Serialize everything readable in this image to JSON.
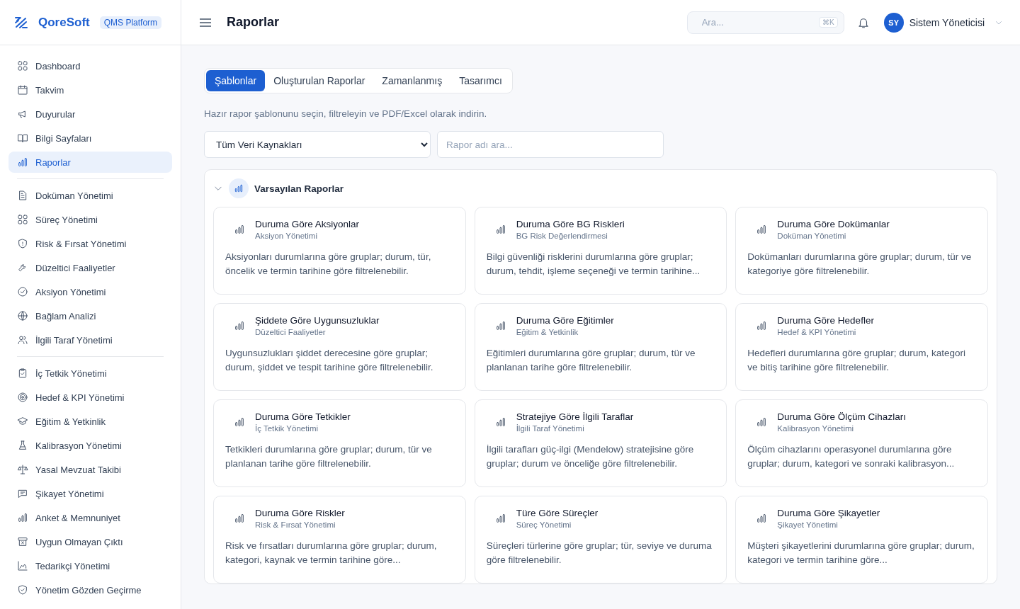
{
  "brand": {
    "name": "QoreSoft",
    "badge": "QMS Platform"
  },
  "sidebar": {
    "groups": [
      {
        "items": [
          {
            "label": "Dashboard",
            "selected": false
          },
          {
            "label": "Takvim",
            "selected": false
          },
          {
            "label": "Duyurular",
            "selected": false
          },
          {
            "label": "Bilgi Sayfaları",
            "selected": false
          },
          {
            "label": "Raporlar",
            "selected": true
          }
        ]
      },
      {
        "items": [
          {
            "label": "Doküman Yönetimi",
            "selected": false
          },
          {
            "label": "Süreç Yönetimi",
            "selected": false
          },
          {
            "label": "Risk & Fırsat Yönetimi",
            "selected": false
          },
          {
            "label": "Düzeltici Faaliyetler",
            "selected": false
          },
          {
            "label": "Aksiyon Yönetimi",
            "selected": false
          },
          {
            "label": "Bağlam Analizi",
            "selected": false
          },
          {
            "label": "İlgili Taraf Yönetimi",
            "selected": false
          }
        ]
      },
      {
        "items": [
          {
            "label": "İç Tetkik Yönetimi",
            "selected": false
          },
          {
            "label": "Hedef & KPI Yönetimi",
            "selected": false
          },
          {
            "label": "Eğitim & Yetkinlik",
            "selected": false
          },
          {
            "label": "Kalibrasyon Yönetimi",
            "selected": false
          },
          {
            "label": "Yasal Mevzuat Takibi",
            "selected": false
          },
          {
            "label": "Şikayet Yönetimi",
            "selected": false
          },
          {
            "label": "Anket & Memnuniyet",
            "selected": false
          },
          {
            "label": "Uygun Olmayan Çıktı",
            "selected": false
          },
          {
            "label": "Tedarikçi Yönetimi",
            "selected": false
          },
          {
            "label": "Yönetim Gözden Geçirme",
            "selected": false
          }
        ]
      }
    ]
  },
  "header": {
    "title": "Raporlar",
    "search": {
      "placeholder": "Ara...",
      "shortcut": "⌘K"
    },
    "user": {
      "initials": "SY",
      "name": "Sistem Yöneticisi"
    }
  },
  "tabs": [
    {
      "label": "Şablonlar",
      "selected": true
    },
    {
      "label": "Oluşturulan Raporlar",
      "selected": false
    },
    {
      "label": "Zamanlanmış",
      "selected": false
    },
    {
      "label": "Tasarımcı",
      "selected": false
    }
  ],
  "intro": "Hazır rapor şablonunu seçin, filtreleyin ve PDF/Excel olarak indirin.",
  "filters": {
    "source": "Tüm Veri Kaynakları",
    "search_placeholder": "Rapor adı ara..."
  },
  "section": {
    "title": "Varsayılan Raporlar",
    "expanded": true,
    "cards": [
      {
        "title": "Duruma Göre Aksiyonlar",
        "module": "Aksiyon Yönetimi",
        "description": "Aksiyonları durumlarına göre gruplar; durum, tür, öncelik ve termin tarihine göre filtrelenebilir."
      },
      {
        "title": "Duruma Göre BG Riskleri",
        "module": "BG Risk Değerlendirmesi",
        "description": "Bilgi güvenliği risklerini durumlarına göre gruplar; durum, tehdit, işleme seçeneği ve termin tarihine..."
      },
      {
        "title": "Duruma Göre Dokümanlar",
        "module": "Doküman Yönetimi",
        "description": "Dokümanları durumlarına göre gruplar; durum, tür ve kategoriye göre filtrelenebilir."
      },
      {
        "title": "Şiddete Göre Uygunsuzluklar",
        "module": "Düzeltici Faaliyetler",
        "description": "Uygunsuzlukları şiddet derecesine göre gruplar; durum, şiddet ve tespit tarihine göre filtrelenebilir."
      },
      {
        "title": "Duruma Göre Eğitimler",
        "module": "Eğitim & Yetkinlik",
        "description": "Eğitimleri durumlarına göre gruplar; durum, tür ve planlanan tarihe göre filtrelenebilir."
      },
      {
        "title": "Duruma Göre Hedefler",
        "module": "Hedef & KPI Yönetimi",
        "description": "Hedefleri durumlarına göre gruplar; durum, kategori ve bitiş tarihine göre filtrelenebilir."
      },
      {
        "title": "Duruma Göre Tetkikler",
        "module": "İç Tetkik Yönetimi",
        "description": "Tetkikleri durumlarına göre gruplar; durum, tür ve planlanan tarihe göre filtrelenebilir."
      },
      {
        "title": "Stratejiye Göre İlgili Taraflar",
        "module": "İlgili Taraf Yönetimi",
        "description": "İlgili tarafları güç-ilgi (Mendelow) stratejisine göre gruplar; durum ve önceliğe göre filtrelenebilir."
      },
      {
        "title": "Duruma Göre Ölçüm Cihazları",
        "module": "Kalibrasyon Yönetimi",
        "description": "Ölçüm cihazlarını operasyonel durumlarına göre gruplar; durum, kategori ve sonraki kalibrasyon..."
      },
      {
        "title": "Duruma Göre Riskler",
        "module": "Risk & Fırsat Yönetimi",
        "description": "Risk ve fırsatları durumlarına göre gruplar; durum, kategori, kaynak ve termin tarihine göre..."
      },
      {
        "title": "Türe Göre Süreçler",
        "module": "Süreç Yönetimi",
        "description": "Süreçleri türlerine göre gruplar; tür, seviye ve duruma göre filtrelenebilir."
      },
      {
        "title": "Duruma Göre Şikayetler",
        "module": "Şikayet Yönetimi",
        "description": "Müşteri şikayetlerini durumlarına göre gruplar; durum, kategori ve termin tarihine göre..."
      }
    ]
  }
}
